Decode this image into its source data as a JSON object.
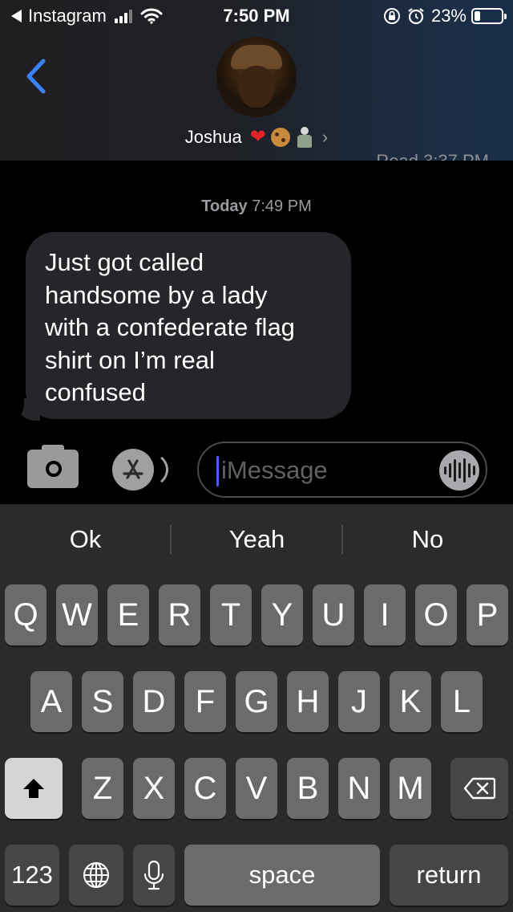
{
  "status_bar": {
    "back_app": "Instagram",
    "time": "7:50 PM",
    "battery_percent": "23%",
    "battery_level": 0.23
  },
  "header": {
    "contact_name": "Joshua",
    "read_receipt": "Read 3:37 PM"
  },
  "conversation": {
    "day_label_day": "Today",
    "day_label_time": "7:49 PM",
    "messages": [
      {
        "direction": "incoming",
        "lines": [
          "Just got called",
          "handsome by a lady",
          "with a confederate flag",
          "shirt on I’m real",
          "confused"
        ]
      }
    ]
  },
  "input": {
    "placeholder": "iMessage"
  },
  "keyboard": {
    "suggestions": [
      "Ok",
      "Yeah",
      "No"
    ],
    "row1": [
      "Q",
      "W",
      "E",
      "R",
      "T",
      "Y",
      "U",
      "I",
      "O",
      "P"
    ],
    "row2": [
      "A",
      "S",
      "D",
      "F",
      "G",
      "H",
      "J",
      "K",
      "L"
    ],
    "row3": [
      "Z",
      "X",
      "C",
      "V",
      "B",
      "N",
      "M"
    ],
    "numbers_key": "123",
    "space_key": "space",
    "return_key": "return"
  },
  "colors": {
    "bubble": "#26252a",
    "key": "#6b6b6e",
    "key_dark": "#464648",
    "keyboard_bg": "#2b2b2d",
    "accent_blue": "#3a82f7"
  },
  "icons": [
    "back-arrow-icon",
    "signal-icon",
    "wifi-icon",
    "orientation-lock-icon",
    "alarm-icon",
    "battery-icon",
    "chevron-left-icon",
    "heart-emoji",
    "cookie-emoji",
    "figure-emoji",
    "chevron-right-icon",
    "camera-icon",
    "app-store-icon",
    "audio-waveform-icon",
    "shift-icon",
    "delete-icon",
    "globe-icon",
    "microphone-icon"
  ]
}
